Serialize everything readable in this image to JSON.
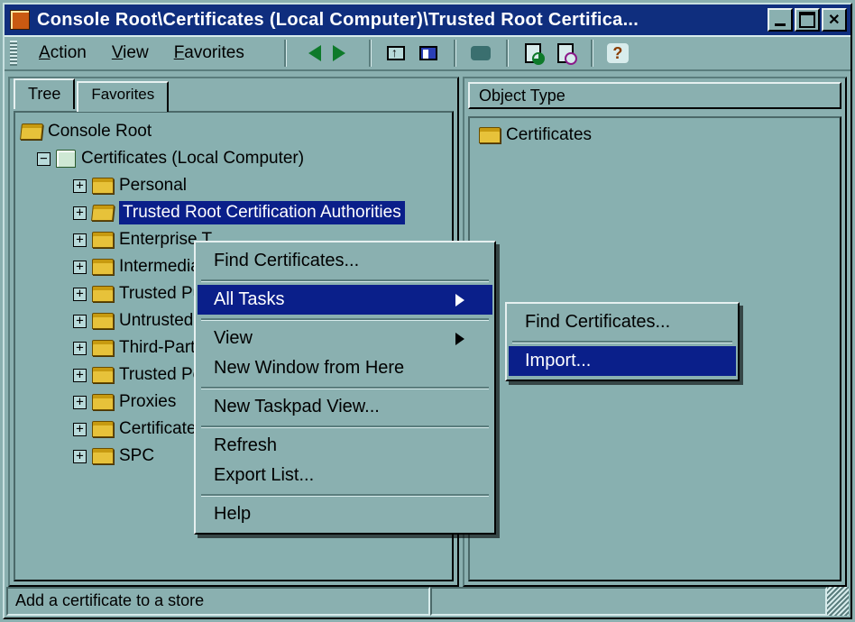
{
  "window": {
    "title": "Console Root\\Certificates (Local Computer)\\Trusted Root Certifica..."
  },
  "menubar": {
    "action": "Action",
    "view": "View",
    "favorites": "Favorites"
  },
  "left_pane": {
    "tabs": {
      "tree": "Tree",
      "favorites": "Favorites"
    },
    "nodes": {
      "console_root": "Console Root",
      "certificates_local": "Certificates (Local Computer)",
      "personal": "Personal",
      "trusted_root_ca": "Trusted Root Certification Authorities",
      "enterprise_trust": "Enterprise T",
      "intermediate_ca": "Intermediate",
      "trusted_publishers": "Trusted Pub",
      "untrusted_certs": "Untrusted C",
      "third_party_root": "Third-Party I",
      "trusted_people": "Trusted Peo",
      "proxies": "Proxies",
      "certificate_enrollment": "Certificate E",
      "spc": "SPC"
    }
  },
  "right_pane": {
    "column_header": "Object Type",
    "items": {
      "certificates": "Certificates"
    }
  },
  "context_menu": {
    "find_certificates": "Find Certificates...",
    "all_tasks": "All Tasks",
    "view": "View",
    "new_window": "New Window from Here",
    "new_taskpad": "New Taskpad View...",
    "refresh": "Refresh",
    "export_list": "Export List...",
    "help": "Help"
  },
  "submenu": {
    "find_certificates": "Find Certificates...",
    "import": "Import..."
  },
  "statusbar": {
    "text": "Add a certificate to a store"
  }
}
